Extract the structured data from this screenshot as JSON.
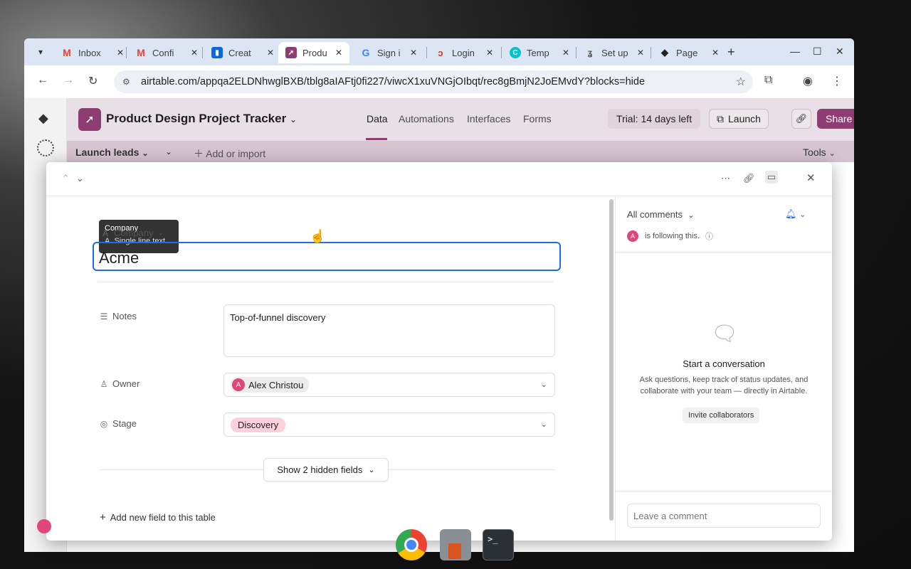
{
  "browser": {
    "tabs": [
      {
        "label": "Inbox",
        "icon": "gmail-icon",
        "color": "#ea4335"
      },
      {
        "label": "Confi",
        "icon": "gmail-icon",
        "color": "#ea4335"
      },
      {
        "label": "Creat",
        "icon": "trello-icon",
        "color": "#0c66e4"
      },
      {
        "label": "Produ",
        "icon": "airtable-icon",
        "color": "#8e3d72"
      },
      {
        "label": "Sign i",
        "icon": "google-icon",
        "color": "#4285f4"
      },
      {
        "label": "Login",
        "icon": "login-icon",
        "color": "#d93025"
      },
      {
        "label": "Temp",
        "icon": "canva-icon",
        "color": "#00c4cc"
      },
      {
        "label": "Set up",
        "icon": "setup-icon",
        "color": "#555555"
      },
      {
        "label": "Page",
        "icon": "page-icon",
        "color": "#222222"
      }
    ],
    "url": "airtable.com/appqa2ELDNhwglBXB/tblg8aIAFtj0fi227/viwcX1xuVNGjOIbqt/rec8gBmjN2JoEMvdY?blocks=hide"
  },
  "airtable": {
    "base_title": "Product Design Project Tracker",
    "nav": [
      "Data",
      "Automations",
      "Interfaces",
      "Forms"
    ],
    "trial": "Trial: 14 days left",
    "launch": "Launch",
    "share": "Share",
    "table_name": "Launch leads",
    "add_import": "Add or import",
    "tools": "Tools"
  },
  "record": {
    "tooltip_title": "Company",
    "tooltip_sub": "Single line text",
    "company_label": "Company",
    "company_value": "Acme",
    "notes_label": "Notes",
    "notes_value": "Top-of-funnel discovery",
    "owner_label": "Owner",
    "owner_initial": "A",
    "owner_value": "Alex Christou",
    "stage_label": "Stage",
    "stage_value": "Discovery",
    "hidden_fields": "Show 2 hidden fields",
    "add_field": "Add new field to this table"
  },
  "comments": {
    "header": "All comments",
    "follow_initial": "A",
    "follow_text": "is following this.",
    "empty_title": "Start a conversation",
    "empty_desc": "Ask questions, keep track of status updates, and collaborate with your team — directly in Airtable.",
    "invite": "Invite collaborators",
    "placeholder": "Leave a comment"
  }
}
